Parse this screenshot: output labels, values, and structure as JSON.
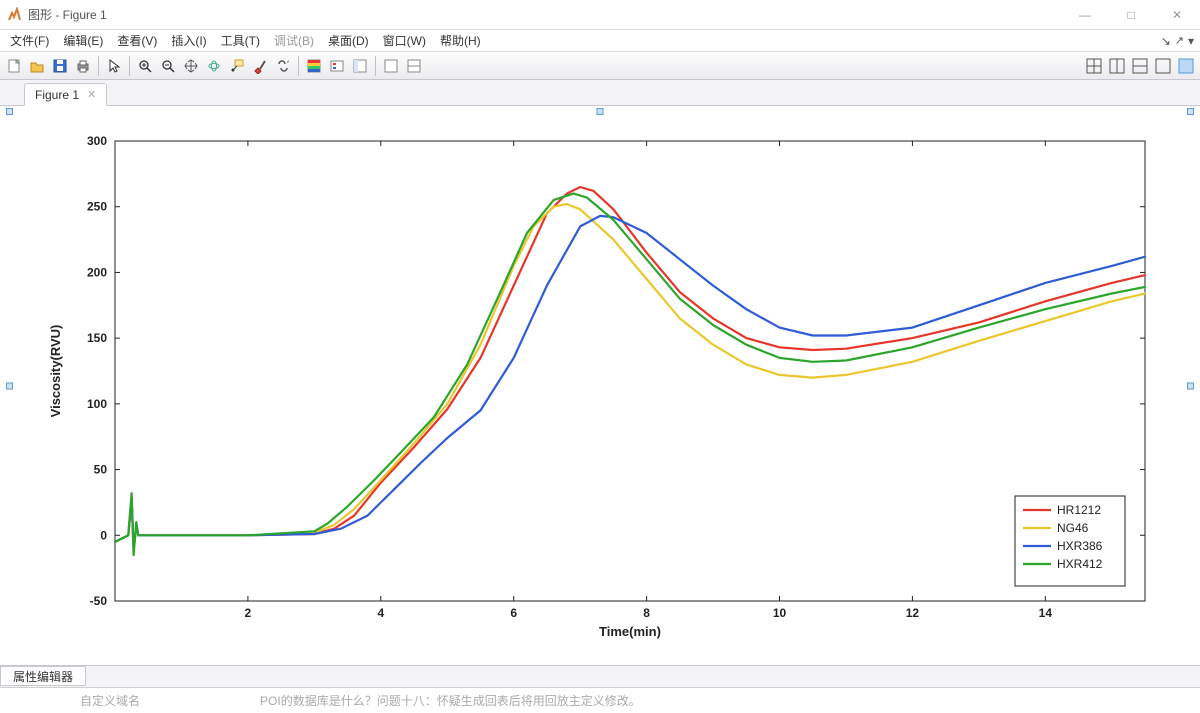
{
  "window": {
    "title": "图形 - Figure 1",
    "minimize_icon": "—",
    "maximize_icon": "□",
    "close_icon": "✕"
  },
  "menubar": {
    "items": [
      {
        "label": "文件(F)",
        "dim": false
      },
      {
        "label": "编辑(E)",
        "dim": false
      },
      {
        "label": "查看(V)",
        "dim": false
      },
      {
        "label": "插入(I)",
        "dim": false
      },
      {
        "label": "工具(T)",
        "dim": false
      },
      {
        "label": "调试(B)",
        "dim": true
      },
      {
        "label": "桌面(D)",
        "dim": false
      },
      {
        "label": "窗口(W)",
        "dim": false
      },
      {
        "label": "帮助(H)",
        "dim": false
      }
    ]
  },
  "toolbar_icons": [
    "new-figure-icon",
    "open-icon",
    "save-icon",
    "print-icon",
    "|",
    "pointer-icon",
    "|",
    "zoom-in-icon",
    "zoom-out-icon",
    "pan-icon",
    "rotate3d-icon",
    "datacursor-icon",
    "brush-icon",
    "linkplots-icon",
    "|",
    "colorbar-icon",
    "legend-icon",
    "hide-plot-tools-icon",
    "|",
    "app-layout-icon",
    "app-layout2-icon"
  ],
  "dock_icons": [
    "layout-grid-icon",
    "layout-cols-icon",
    "layout-rows-icon",
    "layout-single-icon",
    "dock-icon"
  ],
  "tab": {
    "label": "Figure 1",
    "close": "✕"
  },
  "statusbar": {
    "property_editor": "属性编辑器"
  },
  "bottom_cut": {
    "left_fragment": "自定义域名",
    "right_fragment": "POI的数据库是什么？问题十八：怀疑生成回表后将用回放主定义修改。"
  },
  "chart_data": {
    "type": "line",
    "title": "",
    "xlabel": "Time(min)",
    "ylabel": "Viscosity(RVU)",
    "xlim": [
      0,
      15.5
    ],
    "ylim": [
      -50,
      300
    ],
    "xticks": [
      2,
      4,
      6,
      8,
      10,
      12,
      14
    ],
    "yticks": [
      -50,
      0,
      50,
      100,
      150,
      200,
      250,
      300
    ],
    "legend_position": "lower-right",
    "series": [
      {
        "name": "HR1212",
        "color": "#e6352b",
        "x": [
          0,
          0.2,
          0.25,
          0.28,
          0.32,
          0.35,
          0.5,
          1,
          2,
          3,
          3.3,
          3.6,
          4,
          4.5,
          5,
          5.5,
          6,
          6.5,
          6.8,
          7.0,
          7.2,
          7.5,
          8,
          8.5,
          9,
          9.5,
          10,
          10.5,
          11,
          12,
          13,
          14,
          15,
          15.5
        ],
        "y": [
          -5,
          0,
          30,
          -12,
          8,
          0,
          0,
          0,
          0,
          1,
          5,
          15,
          40,
          67,
          96,
          135,
          190,
          245,
          260,
          265,
          262,
          248,
          215,
          185,
          165,
          150,
          143,
          141,
          142,
          150,
          162,
          178,
          192,
          198
        ]
      },
      {
        "name": "NG46",
        "color": "#eac72c",
        "x": [
          0,
          0.2,
          0.25,
          0.28,
          0.32,
          0.35,
          0.5,
          1,
          2,
          3,
          3.3,
          3.6,
          4,
          4.5,
          5,
          5.5,
          6,
          6.3,
          6.6,
          6.8,
          7.0,
          7.5,
          8,
          8.5,
          9,
          9.5,
          10,
          10.5,
          11,
          12,
          13,
          14,
          15,
          15.5
        ],
        "y": [
          -5,
          0,
          25,
          -8,
          6,
          0,
          0,
          0,
          0,
          2,
          8,
          20,
          42,
          70,
          100,
          145,
          205,
          235,
          250,
          252,
          248,
          225,
          195,
          165,
          145,
          130,
          122,
          120,
          122,
          132,
          148,
          163,
          178,
          184
        ]
      },
      {
        "name": "HXR386",
        "color": "#2f5bd6",
        "x": [
          0,
          0.2,
          0.25,
          0.28,
          0.32,
          0.35,
          0.5,
          1,
          2,
          3,
          3.4,
          3.8,
          4.2,
          4.6,
          5,
          5.5,
          6,
          6.5,
          7,
          7.3,
          7.5,
          8,
          8.5,
          9,
          9.5,
          10,
          10.5,
          11,
          12,
          13,
          14,
          15,
          15.5
        ],
        "y": [
          -5,
          0,
          28,
          -10,
          7,
          0,
          0,
          0,
          0,
          1,
          5,
          15,
          35,
          55,
          74,
          95,
          135,
          190,
          235,
          243,
          242,
          230,
          210,
          190,
          172,
          158,
          152,
          152,
          158,
          175,
          192,
          205,
          212
        ]
      },
      {
        "name": "HXR412",
        "color": "#2ca52c",
        "x": [
          0,
          0.2,
          0.25,
          0.28,
          0.32,
          0.35,
          0.5,
          1,
          2,
          3,
          3.2,
          3.5,
          3.9,
          4.3,
          4.8,
          5.3,
          5.8,
          6.2,
          6.6,
          6.9,
          7.1,
          7.5,
          8,
          8.5,
          9,
          9.5,
          10,
          10.5,
          11,
          12,
          13,
          14,
          15,
          15.5
        ],
        "y": [
          -5,
          0,
          32,
          -15,
          10,
          0,
          0,
          0,
          0,
          3,
          9,
          22,
          42,
          63,
          90,
          130,
          185,
          230,
          255,
          260,
          257,
          240,
          210,
          180,
          160,
          145,
          135,
          132,
          133,
          143,
          158,
          172,
          184,
          189
        ]
      }
    ]
  }
}
